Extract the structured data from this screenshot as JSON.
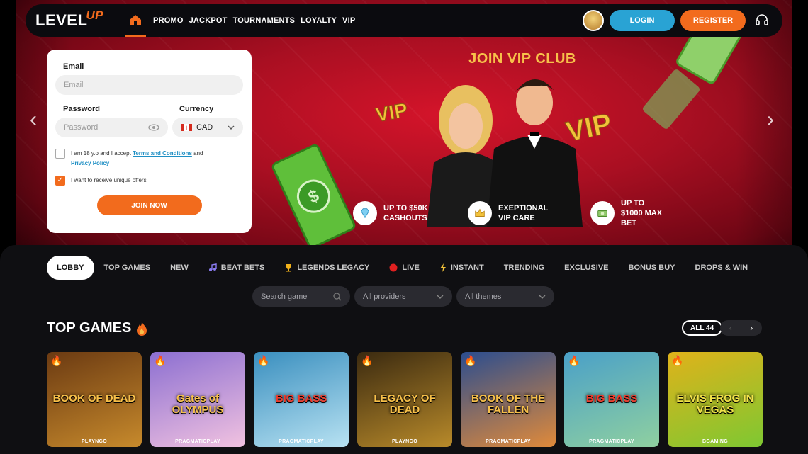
{
  "header": {
    "logo_main": "LEVEL",
    "logo_accent": "UP",
    "nav": [
      "PROMO",
      "JACKPOT",
      "TOURNAMENTS",
      "LOYALTY",
      "VIP"
    ],
    "login": "LOGIN",
    "register": "REGISTER"
  },
  "form": {
    "email_label": "Email",
    "email_placeholder": "Email",
    "password_label": "Password",
    "password_placeholder": "Password",
    "currency_label": "Currency",
    "currency_value": "CAD",
    "terms_prefix": "I am 18 y.o and I accept",
    "terms_link": "Terms and Conditions",
    "terms_and": "and",
    "privacy_link": "Privacy Policy",
    "offers_text": "I want to receive unique offers",
    "join": "JOIN NOW"
  },
  "hero": {
    "title": "JOIN VIP CLUB",
    "features": [
      {
        "icon": "diamond-icon",
        "text": "UP TO $50K CASHOUTS"
      },
      {
        "icon": "crown-icon",
        "text": "EXEPTIONAL VIP CARE"
      },
      {
        "icon": "money-icon",
        "text": "UP TO $1000 MAX BET"
      }
    ]
  },
  "tabs": [
    {
      "label": "LOBBY",
      "icon": ""
    },
    {
      "label": "TOP GAMES",
      "icon": ""
    },
    {
      "label": "NEW",
      "icon": ""
    },
    {
      "label": "BEAT BETS",
      "icon": "music-icon"
    },
    {
      "label": "LEGENDS LEGACY",
      "icon": "trophy-icon"
    },
    {
      "label": "LIVE",
      "icon": "live-dot-icon"
    },
    {
      "label": "INSTANT",
      "icon": "lightning-icon"
    },
    {
      "label": "TRENDING",
      "icon": ""
    },
    {
      "label": "EXCLUSIVE",
      "icon": ""
    },
    {
      "label": "BONUS BUY",
      "icon": ""
    },
    {
      "label": "DROPS & WIN",
      "icon": ""
    }
  ],
  "filters": {
    "search_placeholder": "Search game",
    "providers": "All providers",
    "themes": "All themes"
  },
  "section": {
    "title": "TOP GAMES",
    "all": "ALL 44"
  },
  "games": [
    {
      "name": "BOOK OF DEAD",
      "provider": "PLAYNGO",
      "colors": [
        "#6b3a12",
        "#c78a2c"
      ]
    },
    {
      "name": "Gates of OLYMPUS",
      "provider": "PRAGMATICPLAY",
      "colors": [
        "#8c6fd1",
        "#f1c2e0"
      ]
    },
    {
      "name": "BIG BASS",
      "provider": "PRAGMATICPLAY",
      "colors": [
        "#3a8fbf",
        "#b8e2f2"
      ]
    },
    {
      "name": "LEGACY OF DEAD",
      "provider": "PLAYNGO",
      "colors": [
        "#3b2a10",
        "#b88a2a"
      ]
    },
    {
      "name": "BOOK OF THE FALLEN",
      "provider": "PRAGMATICPLAY",
      "colors": [
        "#2b4d8f",
        "#e08a3a"
      ]
    },
    {
      "name": "BIG BASS",
      "provider": "PRAGMATICPLAY",
      "colors": [
        "#4aa0c8",
        "#8fd0a0"
      ]
    },
    {
      "name": "ELVIS FROG IN VEGAS",
      "provider": "BGAMING",
      "colors": [
        "#e0b21a",
        "#7ec832"
      ]
    }
  ]
}
